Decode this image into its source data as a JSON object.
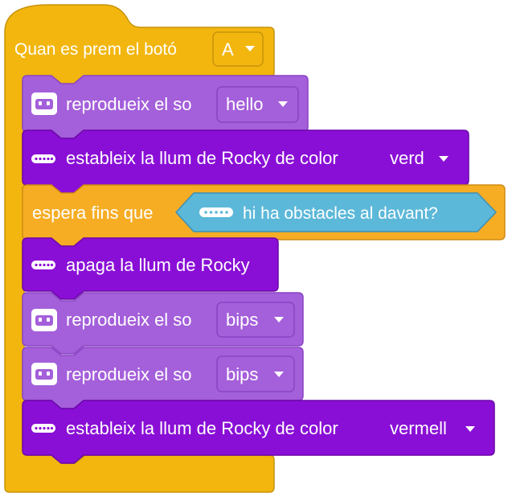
{
  "colors": {
    "events": "#f2b60f",
    "events_dark": "#c8940a",
    "control": "#f6ad24",
    "control_dark": "#cf8b12",
    "sound": "#a45fda",
    "sound_dark": "#8a44c4",
    "light": "#8a0fd6",
    "light_dark": "#6a07a8",
    "sensor": "#5cb8d8",
    "sensor_dark": "#3f8fb4"
  },
  "hat": {
    "label": "Quan es prem el botó",
    "dropdown": "A",
    "dropdown_icon": "chevron-down-icon"
  },
  "blocks": [
    {
      "type": "sound",
      "icon": "robot-face-icon",
      "label": "reprodueix el so",
      "dropdown": "hello"
    },
    {
      "type": "light",
      "icon": "led-strip-icon",
      "label": "estableix la llum de Rocky de color",
      "dropdown": "verd"
    },
    {
      "type": "control",
      "label": "espera fins que",
      "condition": {
        "icon": "led-strip-icon",
        "label": "hi ha obstacles al davant?"
      }
    },
    {
      "type": "light",
      "icon": "led-strip-icon",
      "label": "apaga la llum de Rocky"
    },
    {
      "type": "sound",
      "icon": "robot-face-icon",
      "label": "reprodueix el so",
      "dropdown": "bips"
    },
    {
      "type": "sound",
      "icon": "robot-face-icon",
      "label": "reprodueix el so",
      "dropdown": "bips"
    },
    {
      "type": "light",
      "icon": "led-strip-icon",
      "label": "estableix la llum de Rocky de color",
      "dropdown": "vermell"
    }
  ]
}
